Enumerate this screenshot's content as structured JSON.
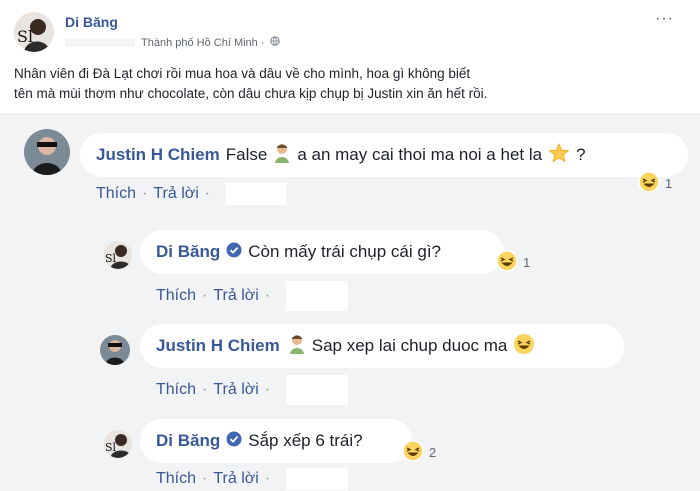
{
  "post": {
    "author": "Di Băng",
    "location": "Thành phố Hồ Chí Minh ·",
    "more_label": "···",
    "text_line1": "Nhân viên đi Đà Lạt chơi rồi mua hoa và dâu về cho mình, hoa gì không biết",
    "text_line2": "tên mà mùi thơm như chocolate, còn dâu chưa kịp chụp bị Justin xin ăn hết rồi."
  },
  "comments": [
    {
      "name": "Justin H Chiem",
      "text_a": "False",
      "text_b": "a an may cai thoi ma noi a het la",
      "text_c": "?",
      "like": "Thích",
      "reply": "Trả lời",
      "reaction_count": "1"
    },
    {
      "name": "Di Băng",
      "text": "Còn mấy trái chụp cái gì?",
      "like": "Thích",
      "reply": "Trả lời",
      "reaction_count": "1"
    },
    {
      "name": "Justin H Chiem",
      "text": "Sap xep lai chup duoc ma",
      "like": "Thích",
      "reply": "Trả lời"
    },
    {
      "name": "Di Băng",
      "text": "Sắp xếp 6 trái?",
      "like": "Thích",
      "reply": "Trả lời",
      "reaction_count": "2"
    }
  ],
  "colors": {
    "link": "#385898",
    "bubble": "#ffffff",
    "area": "#f2f3f5",
    "verified": "#4267b2"
  },
  "icons": [
    "more-options-icon",
    "globe-icon",
    "verified-badge-icon",
    "man-emoji-icon",
    "star-emoji-icon",
    "laughing-emoji-icon",
    "haha-reaction-icon"
  ]
}
